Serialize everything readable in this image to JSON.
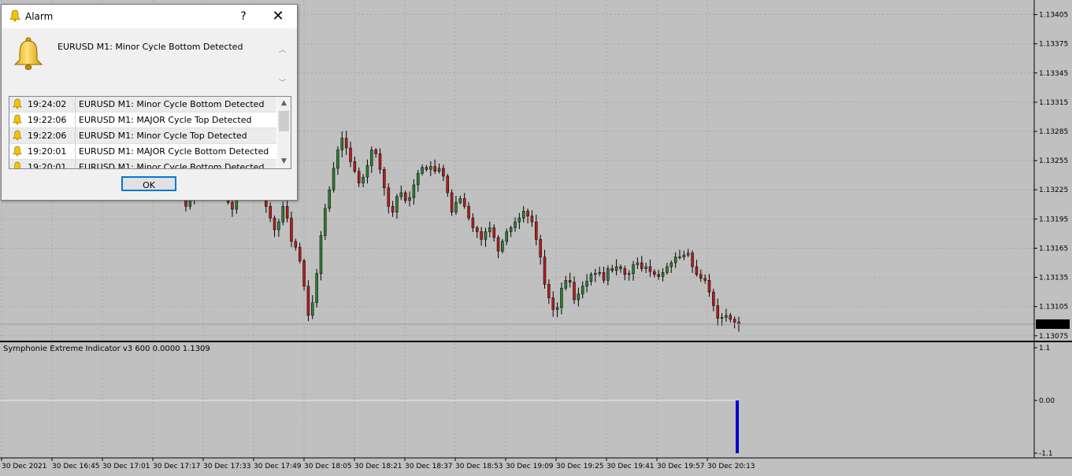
{
  "dialog": {
    "title": "Alarm",
    "help_label": "?",
    "close_label": "✕",
    "message": "EURUSD M1: Minor Cycle Bottom Detected",
    "ok_label": "OK",
    "history": [
      {
        "time": "19:24:02",
        "message": "EURUSD M1: Minor Cycle Bottom Detected"
      },
      {
        "time": "19:22:06",
        "message": "EURUSD M1: MAJOR Cycle Top Detected"
      },
      {
        "time": "19:22:06",
        "message": "EURUSD M1: Minor Cycle Top Detected"
      },
      {
        "time": "19:20:01",
        "message": "EURUSD M1: MAJOR Cycle Bottom Detected"
      },
      {
        "time": "19:20:01",
        "message": "EURUSD M1: Minor Cycle Bottom Detected"
      }
    ]
  },
  "indicator": {
    "label": "Symphonie Extreme Indicator v3 600 0.0000 1.1309",
    "scale_labels": [
      "1.1",
      "0.00",
      "-1.1"
    ]
  },
  "price_axis": {
    "labels": [
      "1.13405",
      "1.13375",
      "1.13345",
      "1.13315",
      "1.13285",
      "1.13255",
      "1.13225",
      "1.13195",
      "1.13165",
      "1.13135",
      "1.13105",
      "1.13075"
    ],
    "current_price": "1.13087"
  },
  "time_axis": {
    "labels": [
      "30 Dec 2021",
      "30 Dec 16:45",
      "30 Dec 17:01",
      "30 Dec 17:17",
      "30 Dec 17:33",
      "30 Dec 17:49",
      "30 Dec 18:05",
      "30 Dec 18:21",
      "30 Dec 18:37",
      "30 Dec 18:53",
      "30 Dec 19:09",
      "30 Dec 19:25",
      "30 Dec 19:41",
      "30 Dec 19:57",
      "30 Dec 20:13"
    ]
  },
  "colors": {
    "background": "#c0c0c0",
    "bull": "#2e7d32",
    "bear": "#b71c1c",
    "wick": "#000000",
    "signal": "#0000cc",
    "grid": "#a8a8a8"
  },
  "chart_data": {
    "type": "candlestick",
    "symbol": "EURUSD",
    "timeframe": "M1",
    "ylim": [
      1.1307,
      1.1342
    ],
    "close": [
      1.13208,
      1.13215,
      1.13222,
      1.1323,
      1.13238,
      1.1323,
      1.13224,
      1.1322,
      1.13232,
      1.13225,
      1.13212,
      1.13205,
      1.1322,
      1.13232,
      1.13245,
      1.13252,
      1.13248,
      1.13236,
      1.13225,
      1.13208,
      1.13196,
      1.13184,
      1.13192,
      1.13208,
      1.13196,
      1.13172,
      1.13166,
      1.13152,
      1.13126,
      1.13096,
      1.13109,
      1.13139,
      1.13178,
      1.13206,
      1.13225,
      1.13247,
      1.13266,
      1.13278,
      1.13268,
      1.13254,
      1.13244,
      1.13232,
      1.13238,
      1.1325,
      1.13266,
      1.13262,
      1.13246,
      1.13227,
      1.13208,
      1.13202,
      1.13218,
      1.13222,
      1.13214,
      1.13217,
      1.1323,
      1.13242,
      1.13248,
      1.13246,
      1.13249,
      1.13244,
      1.13247,
      1.13239,
      1.13222,
      1.13202,
      1.13212,
      1.13216,
      1.13208,
      1.13196,
      1.13186,
      1.13182,
      1.13174,
      1.13182,
      1.13186,
      1.13176,
      1.13162,
      1.13172,
      1.13182,
      1.13186,
      1.13192,
      1.13196,
      1.13203,
      1.13198,
      1.13192,
      1.13174,
      1.13156,
      1.13128,
      1.13114,
      1.13102,
      1.13104,
      1.13124,
      1.13132,
      1.1313,
      1.13112,
      1.13118,
      1.13126,
      1.13131,
      1.13138,
      1.13139,
      1.1314,
      1.13132,
      1.13144,
      1.13142,
      1.13146,
      1.13144,
      1.13138,
      1.13139,
      1.13148,
      1.1315,
      1.13144,
      1.13146,
      1.13141,
      1.13138,
      1.13136,
      1.1314,
      1.13146,
      1.1315,
      1.13156,
      1.13156,
      1.13158,
      1.1316,
      1.13146,
      1.13138,
      1.13134,
      1.13132,
      1.1312,
      1.13106,
      1.13093,
      1.13094,
      1.13096,
      1.13092,
      1.13089,
      1.13087
    ]
  }
}
